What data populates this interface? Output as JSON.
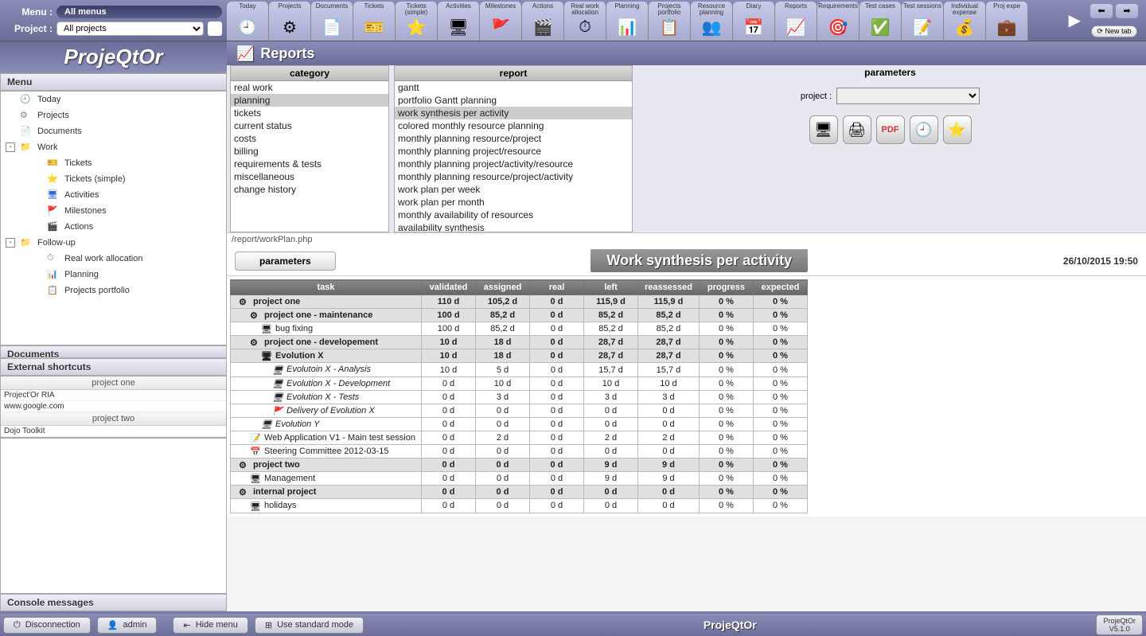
{
  "menu_label": "Menu :",
  "menu_value": "All menus",
  "project_label": "Project :",
  "project_value": "All projects",
  "logo": "ProjeQtOr",
  "toptabs": [
    {
      "l": "Today",
      "i": "🕘"
    },
    {
      "l": "Projects",
      "i": "⚙"
    },
    {
      "l": "Documents",
      "i": "📄"
    },
    {
      "l": "Tickets",
      "i": "🎫"
    },
    {
      "l": "Tickets (simple)",
      "i": "⭐"
    },
    {
      "l": "Activities",
      "i": "🖥"
    },
    {
      "l": "Milestones",
      "i": "🚩"
    },
    {
      "l": "Actions",
      "i": "🎬"
    },
    {
      "l": "Real work allocation",
      "i": "⏱"
    },
    {
      "l": "Planning",
      "i": "📊"
    },
    {
      "l": "Projects portfolio",
      "i": "📋"
    },
    {
      "l": "Resource planning",
      "i": "👥"
    },
    {
      "l": "Diary",
      "i": "📅"
    },
    {
      "l": "Reports",
      "i": "📈"
    },
    {
      "l": "Requirements",
      "i": "🎯"
    },
    {
      "l": "Test cases",
      "i": "✅"
    },
    {
      "l": "Test sessions",
      "i": "📝"
    },
    {
      "l": "Individual expense",
      "i": "💰"
    },
    {
      "l": "Proj expe",
      "i": "💼"
    }
  ],
  "newtab": "New tab",
  "nav": {
    "menu": "Menu",
    "items": [
      {
        "l": "Today",
        "lvl": 0,
        "icon": "🕘",
        "c": "#e90"
      },
      {
        "l": "Projects",
        "lvl": 0,
        "icon": "⚙",
        "c": "#888"
      },
      {
        "l": "Documents",
        "lvl": 0,
        "icon": "📄",
        "c": "#aaa"
      },
      {
        "l": "Work",
        "lvl": 0,
        "icon": "📁",
        "c": "#c80",
        "exp": "-"
      },
      {
        "l": "Tickets",
        "lvl": 2,
        "icon": "🎫",
        "c": "#c80"
      },
      {
        "l": "Tickets (simple)",
        "lvl": 2,
        "icon": "⭐",
        "c": "#c80"
      },
      {
        "l": "Activities",
        "lvl": 2,
        "icon": "🖥",
        "c": "#36c"
      },
      {
        "l": "Milestones",
        "lvl": 2,
        "icon": "🚩",
        "c": "#c33"
      },
      {
        "l": "Actions",
        "lvl": 2,
        "icon": "🎬",
        "c": "#555"
      },
      {
        "l": "Follow-up",
        "lvl": 0,
        "icon": "📁",
        "c": "#888",
        "exp": "-"
      },
      {
        "l": "Real work allocation",
        "lvl": 2,
        "icon": "⏱",
        "c": "#888"
      },
      {
        "l": "Planning",
        "lvl": 2,
        "icon": "📊",
        "c": "#888"
      },
      {
        "l": "Projects portfolio",
        "lvl": 2,
        "icon": "📋",
        "c": "#888"
      }
    ],
    "documents": "Documents",
    "shortcuts": "External shortcuts"
  },
  "shortcuts": {
    "g1": "project one",
    "i1": "Project'Or RIA",
    "i2": "www.google.com",
    "g2": "project two",
    "i3": "Dojo Toolkit"
  },
  "console": "Console messages",
  "page_title": "Reports",
  "headers": {
    "category": "category",
    "report": "report",
    "parameters": "parameters"
  },
  "categories": [
    "real work",
    "planning",
    "tickets",
    "current status",
    "costs",
    "billing",
    "requirements & tests",
    "miscellaneous",
    "change history"
  ],
  "category_selected": 1,
  "reports": [
    "gantt",
    "portfolio Gantt planning",
    "work synthesis per activity",
    "colored monthly resource planning",
    "monthly planning resource/project",
    "monthly planning project/resource",
    "monthly planning project/activity/resource",
    "monthly planning resource/project/activity",
    "work plan per week",
    "work plan per month",
    "monthly availability of resources",
    "availability synthesis"
  ],
  "report_selected": 2,
  "param_project": "project :",
  "report_path": "/report/workPlan.php",
  "param_tab": "parameters",
  "report_title": "Work synthesis per activity",
  "timestamp": "26/10/2015 19:50",
  "columns": [
    "task",
    "validated",
    "assigned",
    "real",
    "left",
    "reassessed",
    "progress",
    "expected"
  ],
  "rows": [
    {
      "b": 1,
      "ind": 0,
      "ic": "⚙",
      "n": "project one",
      "v": [
        "110 d",
        "105,2 d",
        "0 d",
        "115,9 d",
        "115,9 d",
        "0 %",
        "0 %"
      ]
    },
    {
      "b": 1,
      "ind": 1,
      "ic": "⚙",
      "n": "project one - maintenance",
      "v": [
        "100 d",
        "85,2 d",
        "0 d",
        "85,2 d",
        "85,2 d",
        "0 %",
        "0 %"
      ]
    },
    {
      "b": 0,
      "ind": 2,
      "ic": "🖥",
      "n": "bug fixing",
      "v": [
        "100 d",
        "85,2 d",
        "0 d",
        "85,2 d",
        "85,2 d",
        "0 %",
        "0 %"
      ]
    },
    {
      "b": 1,
      "ind": 1,
      "ic": "⚙",
      "n": "project one - developement",
      "v": [
        "10 d",
        "18 d",
        "0 d",
        "28,7 d",
        "28,7 d",
        "0 %",
        "0 %"
      ]
    },
    {
      "b": 1,
      "ind": 2,
      "ic": "🖥",
      "n": "Evolution X",
      "v": [
        "10 d",
        "18 d",
        "0 d",
        "28,7 d",
        "28,7 d",
        "0 %",
        "0 %"
      ]
    },
    {
      "b": 0,
      "ind": 3,
      "ic": "🖥",
      "it": 1,
      "n": "Evolutoin X - Analysis",
      "v": [
        "10 d",
        "5 d",
        "0 d",
        "15,7 d",
        "15,7 d",
        "0 %",
        "0 %"
      ]
    },
    {
      "b": 0,
      "ind": 3,
      "ic": "🖥",
      "it": 1,
      "n": "Evolution X - Development",
      "v": [
        "0 d",
        "10 d",
        "0 d",
        "10 d",
        "10 d",
        "0 %",
        "0 %"
      ]
    },
    {
      "b": 0,
      "ind": 3,
      "ic": "🖥",
      "it": 1,
      "n": "Evolution X - Tests",
      "v": [
        "0 d",
        "3 d",
        "0 d",
        "3 d",
        "3 d",
        "0 %",
        "0 %"
      ]
    },
    {
      "b": 0,
      "ind": 3,
      "ic": "🚩",
      "it": 1,
      "n": "Delivery of Evolution X",
      "v": [
        "0 d",
        "0 d",
        "0 d",
        "0 d",
        "0 d",
        "0 %",
        "0 %"
      ]
    },
    {
      "b": 0,
      "ind": 2,
      "ic": "🖥",
      "it": 1,
      "n": "Evolution Y",
      "v": [
        "0 d",
        "0 d",
        "0 d",
        "0 d",
        "0 d",
        "0 %",
        "0 %"
      ]
    },
    {
      "b": 0,
      "ind": 1,
      "ic": "📝",
      "n": "Web Application V1 - Main test session",
      "v": [
        "0 d",
        "2 d",
        "0 d",
        "2 d",
        "2 d",
        "0 %",
        "0 %"
      ]
    },
    {
      "b": 0,
      "ind": 1,
      "ic": "📅",
      "n": "Steering Committee 2012-03-15",
      "v": [
        "0 d",
        "0 d",
        "0 d",
        "0 d",
        "0 d",
        "0 %",
        "0 %"
      ]
    },
    {
      "b": 1,
      "ind": 0,
      "ic": "⚙",
      "n": "project two",
      "v": [
        "0 d",
        "0 d",
        "0 d",
        "9 d",
        "9 d",
        "0 %",
        "0 %"
      ]
    },
    {
      "b": 0,
      "ind": 1,
      "ic": "🖥",
      "n": "Management",
      "v": [
        "0 d",
        "0 d",
        "0 d",
        "9 d",
        "9 d",
        "0 %",
        "0 %"
      ]
    },
    {
      "b": 1,
      "ind": 0,
      "ic": "⚙",
      "n": "internal project",
      "v": [
        "0 d",
        "0 d",
        "0 d",
        "0 d",
        "0 d",
        "0 %",
        "0 %"
      ]
    },
    {
      "b": 0,
      "ind": 1,
      "ic": "🖥",
      "n": "holidays",
      "v": [
        "0 d",
        "0 d",
        "0 d",
        "0 d",
        "0 d",
        "0 %",
        "0 %"
      ]
    }
  ],
  "bottom": {
    "disconnect": "Disconnection",
    "user": "admin",
    "hidemenu": "Hide menu",
    "stdmode": "Use standard mode",
    "app": "ProjeQtOr",
    "ver1": "ProjeQtOr",
    "ver2": "V5.1.0"
  }
}
